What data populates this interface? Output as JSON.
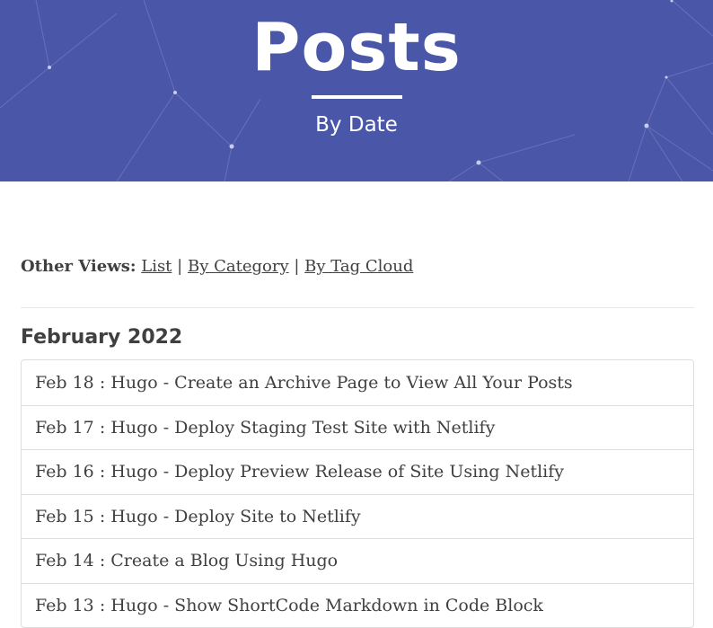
{
  "header": {
    "title": "Posts",
    "subtitle": "By Date",
    "background_color": "#4a57a8"
  },
  "views": {
    "label": "Other Views:",
    "links": [
      {
        "label": "List"
      },
      {
        "label": "By Category"
      },
      {
        "label": "By Tag Cloud"
      }
    ],
    "separator": "|"
  },
  "archive": {
    "month": "February 2022",
    "posts": [
      {
        "date": "Feb 18",
        "title": "Hugo - Create an Archive Page to View All Your Posts"
      },
      {
        "date": "Feb 17",
        "title": "Hugo - Deploy Staging Test Site with Netlify"
      },
      {
        "date": "Feb 16",
        "title": "Hugo - Deploy Preview Release of Site Using Netlify"
      },
      {
        "date": "Feb 15",
        "title": "Hugo - Deploy Site to Netlify"
      },
      {
        "date": "Feb 14",
        "title": "Create a Blog Using Hugo"
      },
      {
        "date": "Feb 13",
        "title": "Hugo - Show ShortCode Markdown in Code Block"
      }
    ]
  }
}
